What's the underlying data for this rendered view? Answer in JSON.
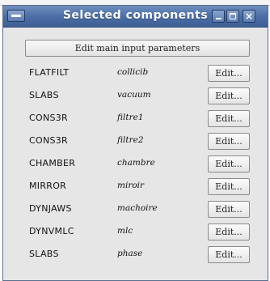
{
  "window": {
    "title": "Selected components"
  },
  "main_button_label": "Edit main input parameters",
  "components": [
    {
      "name": "FLATFILT",
      "id": "collicib",
      "edit_label": "Edit..."
    },
    {
      "name": "SLABS",
      "id": "vacuum",
      "edit_label": "Edit..."
    },
    {
      "name": "CONS3R",
      "id": "filtre1",
      "edit_label": "Edit..."
    },
    {
      "name": "CONS3R",
      "id": "filtre2",
      "edit_label": "Edit..."
    },
    {
      "name": "CHAMBER",
      "id": "chambre",
      "edit_label": "Edit..."
    },
    {
      "name": "MIRROR",
      "id": "miroir",
      "edit_label": "Edit..."
    },
    {
      "name": "DYNJAWS",
      "id": "machoire",
      "edit_label": "Edit..."
    },
    {
      "name": "DYNVMLC",
      "id": "mlc",
      "edit_label": "Edit..."
    },
    {
      "name": "SLABS",
      "id": "phase",
      "edit_label": "Edit..."
    }
  ],
  "colors": {
    "titlebar": "#4d6fa6",
    "window_bg": "#e6e6e6"
  }
}
